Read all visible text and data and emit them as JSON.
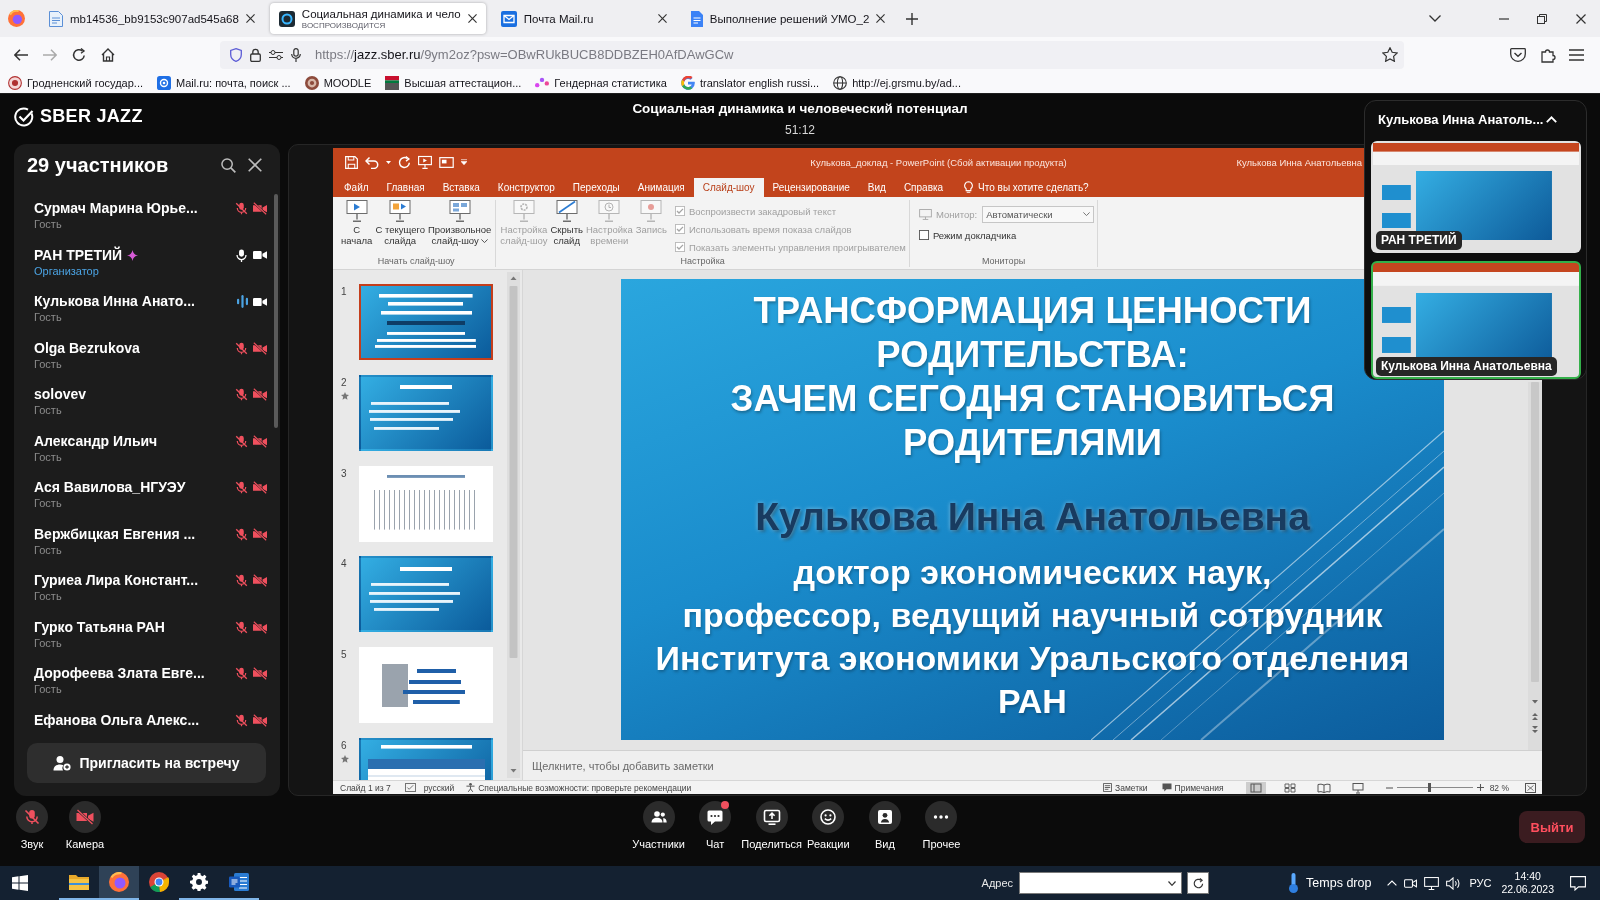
{
  "browser": {
    "tabs": [
      {
        "kind": "page",
        "title": "mb14536_bb9153c907ad545a68",
        "selected": false
      },
      {
        "kind": "video",
        "title": "Социальная динамика и чело",
        "subtitle": "ВОСПРОИЗВОДИТСЯ",
        "selected": true
      },
      {
        "kind": "mail",
        "title": "Почта Mail.ru",
        "selected": false
      },
      {
        "kind": "doc",
        "title": "Выполнение решений УМО_2",
        "selected": false
      }
    ],
    "url": "https://jazz.sber.ru/9ym2oz?psw=OBwRUkBUCB8DDBZEH0AfDAwGCw",
    "bookmarks": [
      {
        "kind": "crest",
        "label": "Гродненский государ..."
      },
      {
        "kind": "mail",
        "label": "Mail.ru: почта, поиск ..."
      },
      {
        "kind": "moodle",
        "label": "MOODLE"
      },
      {
        "kind": "flag",
        "label": "Высшая аттестацион..."
      },
      {
        "kind": "stats",
        "label": "Гендерная статистика"
      },
      {
        "kind": "google",
        "label": "translator english russi..."
      },
      {
        "kind": "globe",
        "label": "http://ej.grsmu.by/ad..."
      }
    ]
  },
  "meeting": {
    "logo": "SBER JAZZ",
    "title": "Социальная динамика и человеческий потенциал",
    "timer": "51:12"
  },
  "participants_panel": {
    "title": "29 участников",
    "participants": [
      {
        "name": "Сурмач Марина Юрье...",
        "role": "Гость",
        "organizer": false,
        "mic_muted": true,
        "speaking": false,
        "camera_on": false
      },
      {
        "name": "РАН ТРЕТИЙ",
        "role": "Организатор",
        "organizer": true,
        "mic_muted": false,
        "speaking": false,
        "camera_on": true
      },
      {
        "name": "Кулькова Инна Анато...",
        "role": "Гость",
        "organizer": false,
        "mic_muted": false,
        "speaking": true,
        "camera_on": true
      },
      {
        "name": "Olga Bezrukova",
        "role": "Гость",
        "organizer": false,
        "mic_muted": true,
        "speaking": false,
        "camera_on": false
      },
      {
        "name": "solovev",
        "role": "Гость",
        "organizer": false,
        "mic_muted": true,
        "speaking": false,
        "camera_on": false
      },
      {
        "name": "Александр Ильич",
        "role": "Гость",
        "organizer": false,
        "mic_muted": true,
        "speaking": false,
        "camera_on": false
      },
      {
        "name": "Ася Вавилова_НГУЭУ",
        "role": "Гость",
        "organizer": false,
        "mic_muted": true,
        "speaking": false,
        "camera_on": false
      },
      {
        "name": "Вержбицкая Евгения ...",
        "role": "Гость",
        "organizer": false,
        "mic_muted": true,
        "speaking": false,
        "camera_on": false
      },
      {
        "name": "Гуриеа Лира Констант...",
        "role": "Гость",
        "organizer": false,
        "mic_muted": true,
        "speaking": false,
        "camera_on": false
      },
      {
        "name": "Гурко Татьяна РАН",
        "role": "Гость",
        "organizer": false,
        "mic_muted": true,
        "speaking": false,
        "camera_on": false
      },
      {
        "name": "Дорофеева Злата Евге...",
        "role": "Гость",
        "organizer": false,
        "mic_muted": true,
        "speaking": false,
        "camera_on": false
      },
      {
        "name": "Ефанова Ольга Алекс...",
        "organizer": false,
        "mic_muted": true,
        "speaking": false,
        "camera_on": false
      }
    ],
    "invite_button": "Пригласить на встречу"
  },
  "screen_share": {
    "window": {
      "title": "Кулькова_доклад - PowerPoint (Сбой активации продукта)",
      "user": "Кулькова Инна Анатольевна",
      "tabs": [
        {
          "label": "Файл",
          "selected": false
        },
        {
          "label": "Главная",
          "selected": false
        },
        {
          "label": "Вставка",
          "selected": false
        },
        {
          "label": "Конструктор",
          "selected": false
        },
        {
          "label": "Переходы",
          "selected": false
        },
        {
          "label": "Анимация",
          "selected": false
        },
        {
          "label": "Слайд-шоу",
          "selected": true
        },
        {
          "label": "Рецензирование",
          "selected": false
        },
        {
          "label": "Вид",
          "selected": false
        },
        {
          "label": "Справка",
          "selected": false
        }
      ],
      "tell_me": "Что вы хотите сделать?",
      "ribbon_groups": [
        {
          "label": "Начать слайд-шоу",
          "buttons": [
            {
              "kind": "start",
              "label": "С\nначала",
              "disabled": false,
              "dropdown": false
            },
            {
              "kind": "current",
              "label": "С текущего\nслайда",
              "disabled": false,
              "dropdown": false
            },
            {
              "kind": "custom",
              "label": "Произвольное\nслайд-шоу",
              "disabled": false,
              "dropdown": true
            }
          ]
        },
        {
          "label": "Настройка",
          "buttons": [
            {
              "kind": "setup",
              "label": "Настройка\nслайд-шоу",
              "disabled": true,
              "dropdown": false
            },
            {
              "kind": "hide",
              "label": "Скрыть\nслайд",
              "disabled": false,
              "dropdown": false
            },
            {
              "kind": "timing",
              "label": "Настройка\nвремени",
              "disabled": true,
              "dropdown": false
            },
            {
              "kind": "record",
              "label": "Запись",
              "disabled": true,
              "dropdown": false
            }
          ],
          "checkboxes": [
            {
              "label": "Воспроизвести закадровый текст",
              "checked": true,
              "disabled": true
            },
            {
              "label": "Использовать время показа слайдов",
              "checked": true,
              "disabled": true
            },
            {
              "label": "Показать элементы управления проигрывателем",
              "checked": true,
              "disabled": true
            }
          ]
        },
        {
          "label": "Мониторы",
          "monitor": {
            "label": "Монитор:",
            "value": "Автоматически",
            "disabled": true
          },
          "checkboxes": [
            {
              "label": "Режим докладчика",
              "checked": false,
              "disabled": false
            }
          ]
        }
      ],
      "slides": [
        {
          "number": "1",
          "kind": "title",
          "selected": true,
          "animated": false
        },
        {
          "number": "2",
          "kind": "text",
          "selected": false,
          "animated": true
        },
        {
          "number": "3",
          "kind": "chart",
          "selected": false,
          "animated": false
        },
        {
          "number": "4",
          "kind": "text",
          "selected": false,
          "animated": false
        },
        {
          "number": "5",
          "kind": "bars",
          "selected": false,
          "animated": false
        },
        {
          "number": "6",
          "kind": "table",
          "selected": false,
          "animated": true
        }
      ],
      "slide": {
        "title": "ТРАНСФОРМАЦИЯ ЦЕННОСТИ\nРОДИТЕЛЬСТВА:\nЗАЧЕМ СЕГОДНЯ СТАНОВИТЬСЯ\nРОДИТЕЛЯМИ",
        "author": "Кулькова Инна Анатольевна",
        "affiliation": "доктор экономических наук,\nпрофессор, ведущий научный сотрудник\nИнститута экономики Уральского отделения\nРАН"
      },
      "notes": {
        "placeholder": "Щелкните, чтобы добавить заметки"
      },
      "status_bar": {
        "slide": "Слайд 1 из 7",
        "language": "русский",
        "accessibility": "Специальные возможности: проверьте рекомендации",
        "notes": "Заметки",
        "comments": "Примечания",
        "views": [
          {
            "kind": "normal",
            "selected": true
          },
          {
            "kind": "sorter",
            "selected": false
          },
          {
            "kind": "reading",
            "selected": false
          },
          {
            "kind": "slideshow",
            "selected": false
          }
        ],
        "zoom_slider": {
          "level": 0.42
        },
        "zoom": "82 %"
      }
    }
  },
  "speaker_panel": {
    "title": "Кулькова Инна Анатоль...",
    "expanded": true,
    "tiles": [
      {
        "name": "РАН ТРЕТИЙ",
        "speaking": false
      },
      {
        "name": "Кулькова Инна Анатольевна",
        "speaking": true
      }
    ]
  },
  "controls": {
    "left": [
      {
        "kind": "microphone",
        "label": "Звук",
        "on": false
      },
      {
        "kind": "camera",
        "label": "Камера",
        "on": false
      }
    ],
    "center": [
      {
        "kind": "participants",
        "label": "Участники",
        "unread": false
      },
      {
        "kind": "chat",
        "label": "Чат",
        "unread": true
      },
      {
        "kind": "share",
        "label": "Поделиться",
        "unread": false
      },
      {
        "kind": "reactions",
        "label": "Реакции",
        "unread": false
      },
      {
        "kind": "view",
        "label": "Вид",
        "unread": false
      },
      {
        "kind": "more",
        "label": "Прочее",
        "unread": false
      }
    ],
    "leave_button": "Выйти"
  },
  "taskbar": {
    "apps": [
      {
        "kind": "explorer",
        "selected": false,
        "running": true
      },
      {
        "kind": "firefox",
        "selected": true,
        "running": true
      },
      {
        "kind": "chrome",
        "selected": false,
        "running": false
      },
      {
        "kind": "settings",
        "selected": false,
        "running": true
      },
      {
        "kind": "word",
        "selected": false,
        "running": true
      }
    ],
    "address_label": "Адрес",
    "weather": "Temps drop",
    "language": "РУС",
    "time": "14:40",
    "date": "22.06.2023"
  }
}
